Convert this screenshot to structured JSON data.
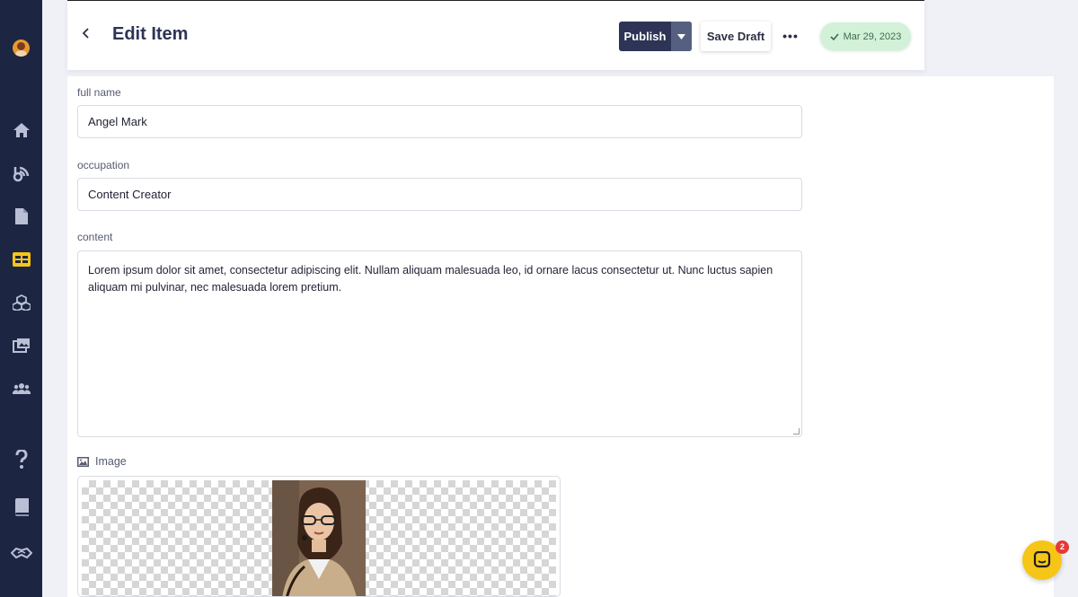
{
  "sidebar": {
    "items": [
      {
        "icon": "home-icon"
      },
      {
        "icon": "blog-icon"
      },
      {
        "icon": "document-icon"
      },
      {
        "icon": "table-icon",
        "active": true
      },
      {
        "icon": "blocks-icon"
      },
      {
        "icon": "media-icon"
      },
      {
        "icon": "users-icon"
      },
      {
        "icon": "help-icon"
      },
      {
        "icon": "book-icon"
      },
      {
        "icon": "handshake-icon"
      }
    ],
    "active_color": "#f5c518",
    "icon_color": "#b9c0d6"
  },
  "header": {
    "title": "Edit Item",
    "publish_label": "Publish",
    "save_draft_label": "Save Draft",
    "more_label": "•••",
    "date": "Mar 29, 2023"
  },
  "form": {
    "full_name": {
      "label": "full name",
      "value": "Angel Mark"
    },
    "occupation": {
      "label": "occupation",
      "value": "Content Creator"
    },
    "content": {
      "label": "content",
      "value": "Lorem ipsum dolor sit amet, consectetur adipiscing elit. Nullam aliquam malesuada leo, id ornare lacus consectetur ut. Nunc luctus sapien aliquam mi pulvinar, nec malesuada lorem pretium."
    },
    "image": {
      "label": "Image"
    }
  },
  "chat": {
    "unread_count": "2"
  }
}
